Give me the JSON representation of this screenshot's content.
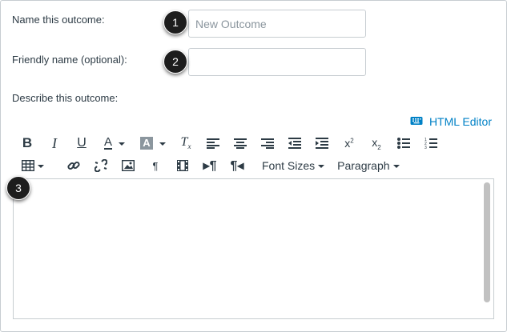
{
  "form": {
    "name_label": "Name this outcome:",
    "name_placeholder": "New Outcome",
    "name_value": "",
    "friendly_label": "Friendly name (optional):",
    "friendly_placeholder": "",
    "friendly_value": "",
    "describe_label": "Describe this outcome:"
  },
  "callouts": [
    "1",
    "2",
    "3"
  ],
  "editor": {
    "html_editor_label": "HTML Editor",
    "font_sizes_label": "Font Sizes",
    "paragraph_label": "Paragraph",
    "toolbar_row1": [
      "bold-icon",
      "italic-icon",
      "underline-icon",
      "text-color-icon",
      "background-color-icon",
      "clear-formatting-icon",
      "align-left-icon",
      "align-center-icon",
      "align-right-icon",
      "outdent-icon",
      "indent-icon",
      "superscript-icon",
      "subscript-icon",
      "bullet-list-icon",
      "numbered-list-icon"
    ],
    "toolbar_row2": [
      "table-icon",
      "link-icon",
      "unlink-icon",
      "image-icon",
      "paragraph-mark-icon",
      "media-icon",
      "ltr-icon",
      "rtl-icon"
    ]
  },
  "colors": {
    "accent": "#0081c6",
    "text": "#2d3b45",
    "border": "#c7cdd1",
    "badge": "#1d1d1d"
  }
}
